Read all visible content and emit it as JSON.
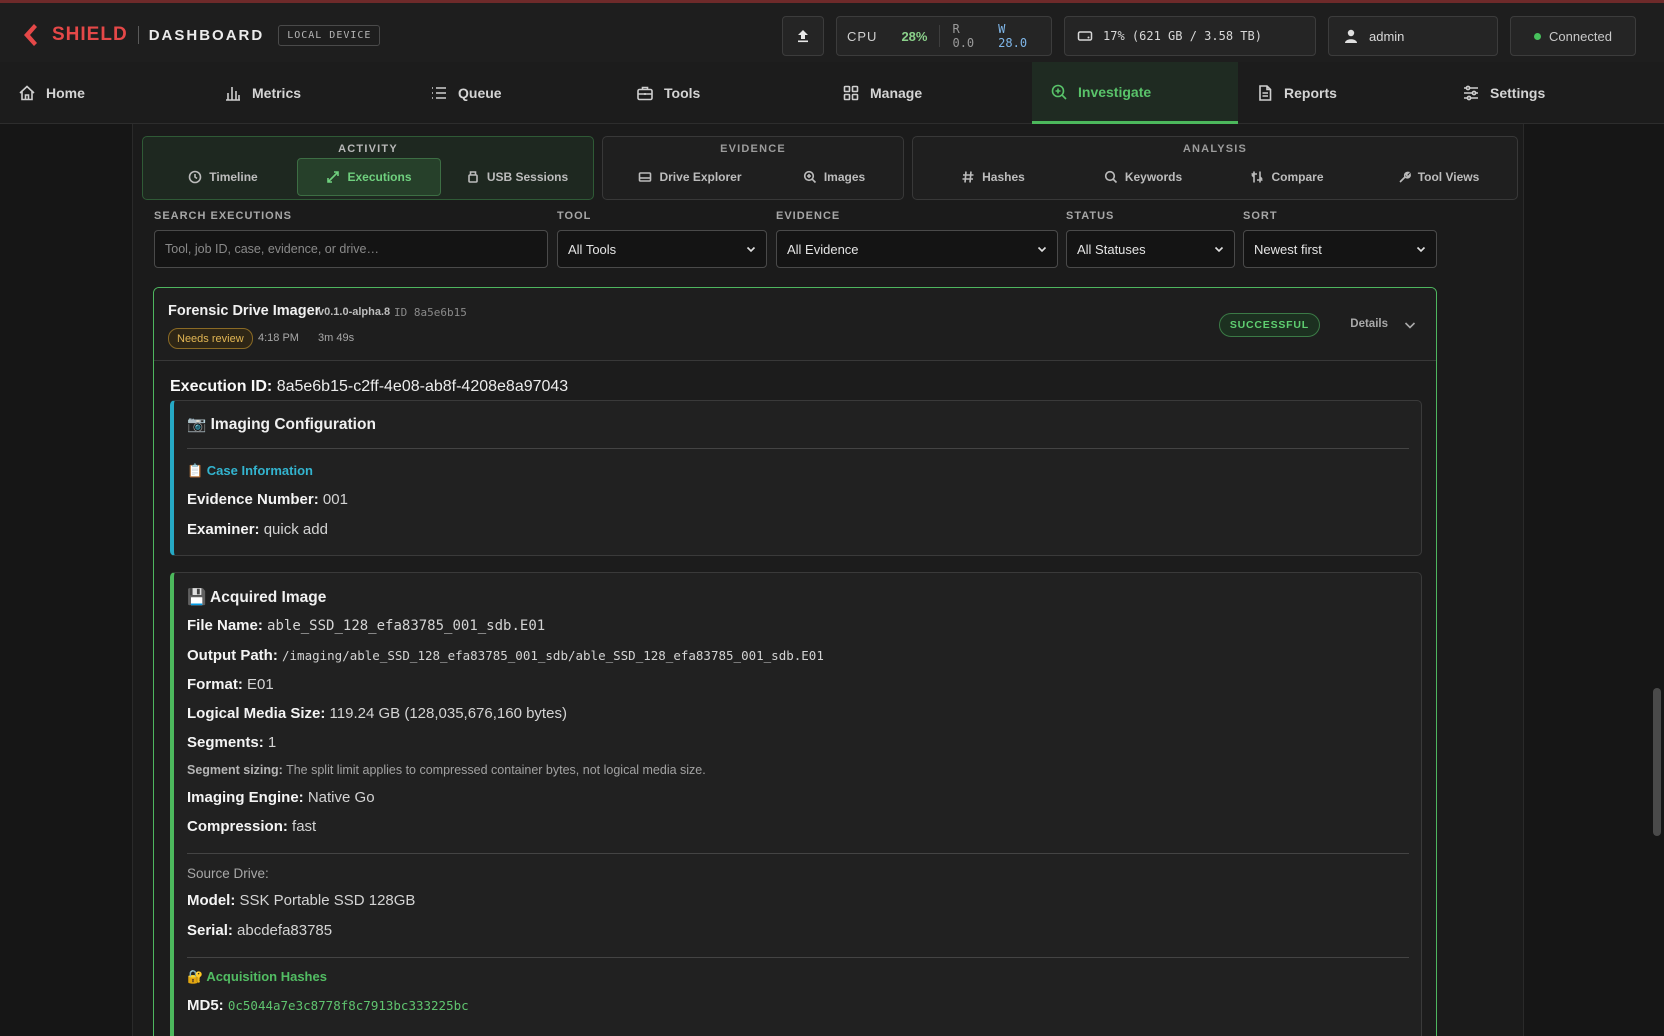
{
  "header": {
    "brand": "SHIELD",
    "subtitle": "DASHBOARD",
    "device": "LOCAL DEVICE",
    "cpu_label": "CPU",
    "cpu_value": "28%",
    "read": "R 0.0",
    "write": "W 28.0",
    "disk": "17% (621 GB / 3.58 TB)",
    "user": "admin",
    "connection": "Connected"
  },
  "nav": [
    {
      "label": "Home",
      "icon": "home-icon"
    },
    {
      "label": "Metrics",
      "icon": "bar-chart-icon"
    },
    {
      "label": "Queue",
      "icon": "list-icon"
    },
    {
      "label": "Tools",
      "icon": "toolbox-icon"
    },
    {
      "label": "Manage",
      "icon": "grid-icon"
    },
    {
      "label": "Investigate",
      "icon": "search-plus-icon",
      "active": true
    },
    {
      "label": "Reports",
      "icon": "document-icon"
    },
    {
      "label": "Settings",
      "icon": "sliders-icon"
    }
  ],
  "subnav": {
    "activity": {
      "title": "ACTIVITY",
      "items": [
        "Timeline",
        "Executions",
        "USB Sessions"
      ],
      "active": "Executions"
    },
    "evidence": {
      "title": "EVIDENCE",
      "items": [
        "Drive Explorer",
        "Images"
      ]
    },
    "analysis": {
      "title": "ANALYSIS",
      "items": [
        "Hashes",
        "Keywords",
        "Compare",
        "Tool Views"
      ]
    }
  },
  "filters": {
    "search_label": "SEARCH EXECUTIONS",
    "search_placeholder": "Tool, job ID, case, evidence, or drive…",
    "tool_label": "TOOL",
    "tool_value": "All Tools",
    "evidence_label": "EVIDENCE",
    "evidence_value": "All Evidence",
    "status_label": "STATUS",
    "status_value": "All Statuses",
    "sort_label": "SORT",
    "sort_value": "Newest first"
  },
  "execution": {
    "tool": "Forensic Drive Imager",
    "version": "v0.1.0-alpha.8",
    "short_id": "ID 8a5e6b15",
    "review": "Needs review",
    "time": "4:18 PM",
    "duration": "3m 49s",
    "status": "SUCCESSFUL",
    "details": "Details",
    "id_label": "Execution ID:",
    "id": "8a5e6b15-c2ff-4e08-ab8f-4208e8a97043",
    "config": {
      "title": "📷 Imaging Configuration",
      "case_title": "📋 Case Information",
      "evidence_label": "Evidence Number:",
      "evidence": "001",
      "examiner_label": "Examiner:",
      "examiner": "quick add"
    },
    "image": {
      "title": "💾 Acquired Image",
      "file_label": "File Name:",
      "file": "able_SSD_128_efa83785_001_sdb.E01",
      "path_label": "Output Path:",
      "path": "/imaging/able_SSD_128_efa83785_001_sdb/able_SSD_128_efa83785_001_sdb.E01",
      "format_label": "Format:",
      "format": "E01",
      "size_label": "Logical Media Size:",
      "size": "119.24 GB (128,035,676,160 bytes)",
      "segments_label": "Segments:",
      "segments": "1",
      "sizing_label": "Segment sizing:",
      "sizing": "The split limit applies to compressed container bytes, not logical media size.",
      "engine_label": "Imaging Engine:",
      "engine": "Native Go",
      "compression_label": "Compression:",
      "compression": "fast",
      "source_title": "Source Drive:",
      "model_label": "Model:",
      "model": "SSK Portable SSD 128GB",
      "serial_label": "Serial:",
      "serial": "abcdefa83785",
      "hashes_title": "🔐 Acquisition Hashes",
      "md5_label": "MD5:",
      "md5": "0c5044a7e3c8778f8c7913bc333225bc"
    }
  },
  "colors": {
    "accent": "#4cb85c",
    "brand": "#e54848",
    "cyan": "#26a9c5",
    "warning": "#e2b654"
  }
}
